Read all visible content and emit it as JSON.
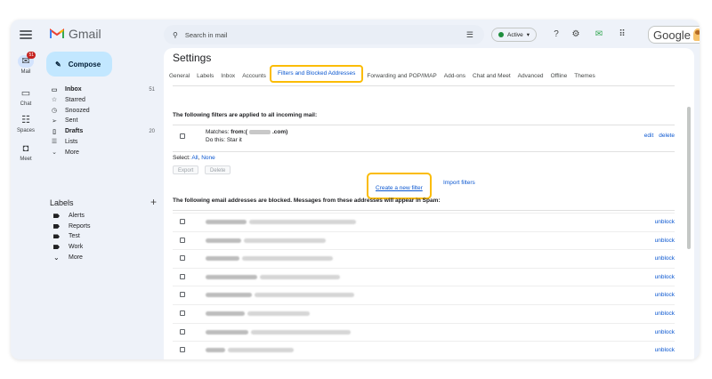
{
  "rail": {
    "items": [
      {
        "label": "Mail",
        "badge": "51"
      },
      {
        "label": "Chat"
      },
      {
        "label": "Spaces"
      },
      {
        "label": "Meet"
      }
    ]
  },
  "app": {
    "name": "Gmail"
  },
  "compose": {
    "label": "Compose"
  },
  "nav": [
    {
      "label": "Inbox",
      "count": "51",
      "bold": true,
      "icon": "inbox-icon"
    },
    {
      "label": "Starred",
      "count": "",
      "icon": "star-icon"
    },
    {
      "label": "Snoozed",
      "count": "",
      "icon": "clock-icon"
    },
    {
      "label": "Sent",
      "count": "",
      "icon": "send-icon"
    },
    {
      "label": "Drafts",
      "count": "20",
      "bold": true,
      "icon": "draft-icon"
    },
    {
      "label": "Lists",
      "count": "",
      "icon": "list-icon"
    },
    {
      "label": "More",
      "count": "",
      "icon": "chevron-down-icon"
    }
  ],
  "labels": {
    "title": "Labels",
    "items": [
      "Alerts",
      "Reports",
      "Test",
      "Work"
    ],
    "more": "More"
  },
  "search": {
    "placeholder": "Search in mail"
  },
  "status": {
    "label": "Active",
    "color": "#1e8e3e"
  },
  "brand": {
    "word": "Google"
  },
  "settings": {
    "title": "Settings",
    "tabs": [
      "General",
      "Labels",
      "Inbox",
      "Accounts",
      "Filters and Blocked Addresses",
      "Forwarding and POP/IMAP",
      "Add-ons",
      "Chat and Meet",
      "Advanced",
      "Offline",
      "Themes"
    ],
    "active_tab": "Filters and Blocked Addresses",
    "filters_heading": "The following filters are applied to all incoming mail:",
    "filter": {
      "matches_prefix": "Matches: ",
      "matches_query": "from:(",
      "matches_suffix": ".com)",
      "action": "Do this: Star it",
      "edit": "edit",
      "delete": "delete"
    },
    "select": {
      "prefix": "Select: ",
      "all": "All",
      "sep": ", ",
      "none": "None"
    },
    "export": "Export",
    "delete_btn": "Delete",
    "create_filter": "Create a new filter",
    "import_filters": "Import filters",
    "blocked_heading": "The following email addresses are blocked. Messages from these addresses will appear in Spam:",
    "unblock": "unblock",
    "blocked_count": 9
  },
  "colors": {
    "accent": "#0b57d0",
    "highlight": "#fbbc04",
    "compose_bg": "#c2e7ff",
    "shell_bg": "#eef2f9"
  }
}
